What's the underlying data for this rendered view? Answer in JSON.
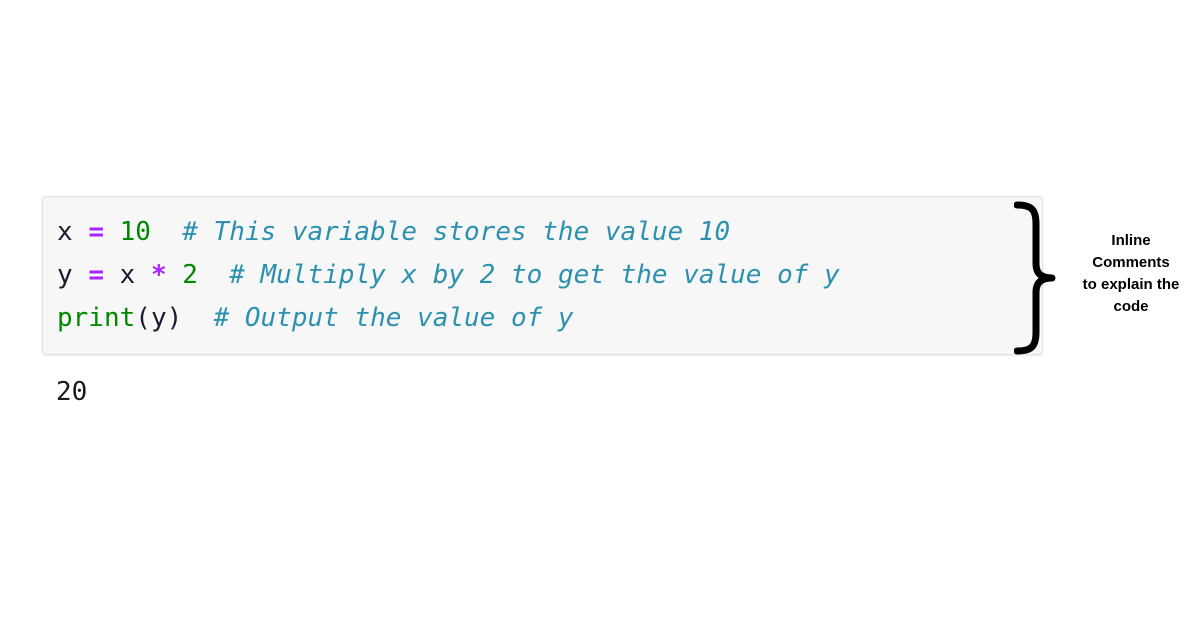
{
  "page": {
    "background_color": "#ffffff"
  },
  "code_block": {
    "background_color": "#f7f7f7",
    "border_color": "#e0e0e0",
    "language": "python",
    "lines": [
      {
        "tokens": [
          {
            "text": "x",
            "type": "variable"
          },
          {
            "text": " ",
            "type": "plain"
          },
          {
            "text": "=",
            "type": "operator"
          },
          {
            "text": " ",
            "type": "plain"
          },
          {
            "text": "10",
            "type": "number"
          },
          {
            "text": "  ",
            "type": "plain"
          },
          {
            "text": "# This variable stores the value 10",
            "type": "comment"
          }
        ]
      },
      {
        "tokens": [
          {
            "text": "y",
            "type": "variable"
          },
          {
            "text": " ",
            "type": "plain"
          },
          {
            "text": "=",
            "type": "operator"
          },
          {
            "text": " ",
            "type": "plain"
          },
          {
            "text": "x",
            "type": "variable"
          },
          {
            "text": " ",
            "type": "plain"
          },
          {
            "text": "*",
            "type": "operator"
          },
          {
            "text": " ",
            "type": "plain"
          },
          {
            "text": "2",
            "type": "number"
          },
          {
            "text": "  ",
            "type": "plain"
          },
          {
            "text": "# Multiply x by 2 to get the value of y",
            "type": "comment"
          }
        ]
      },
      {
        "tokens": [
          {
            "text": "print",
            "type": "function"
          },
          {
            "text": "(",
            "type": "punctuation"
          },
          {
            "text": "y",
            "type": "variable"
          },
          {
            "text": ")",
            "type": "punctuation"
          },
          {
            "text": "  ",
            "type": "plain"
          },
          {
            "text": "# Output the value of y",
            "type": "comment"
          }
        ]
      }
    ],
    "plain_text": "x = 10  # This variable stores the value 10\ny = x * 2  # Multiply x by 2 to get the value of y\nprint(y)  # Output the value of y"
  },
  "output": {
    "value": "20"
  },
  "annotation": {
    "brace_icon": "curly-brace-right-icon",
    "brace_color": "#000000",
    "label_lines": [
      "Inline",
      "Comments",
      "to explain the",
      "code"
    ],
    "label_text": "Inline Comments to explain the code"
  },
  "syntax_colors": {
    "variable": "#1a1a2e",
    "operator": "#aa22ff",
    "number": "#008800",
    "function": "#008800",
    "punctuation": "#1a1a2e",
    "comment": "#2b91af"
  }
}
